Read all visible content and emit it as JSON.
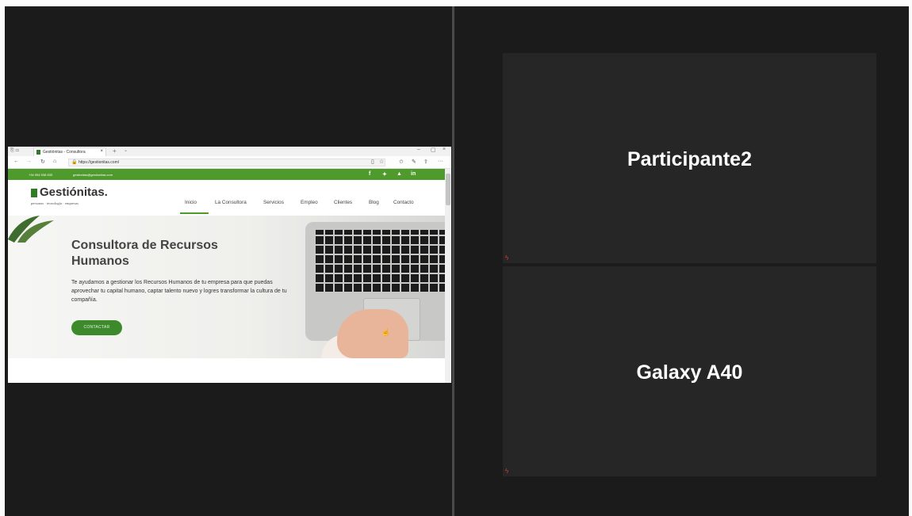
{
  "shared_browser": {
    "tab_title": "Gestiónitas - Consultora",
    "tab_close": "×",
    "new_tab": "+",
    "tab_list": "⌄",
    "window_controls": {
      "minimize": "–",
      "maximize": "▢",
      "close": "×"
    },
    "tab_action_icons": "⎘ ▭",
    "toolbar": {
      "back": "←",
      "forward": "→",
      "refresh": "↻",
      "home": "⌂",
      "lock": "🔒",
      "url": "https://gestionitas.com/",
      "reading_view": "▯",
      "favorite": "☆",
      "favorites": "✩",
      "notes": "✎",
      "share": "⇪",
      "more": "···"
    },
    "site": {
      "topbar_phone": "+34 954 538 833",
      "topbar_email": "gestiontas@gestionitas.com",
      "social": [
        "f",
        "✦",
        "▲",
        "in"
      ],
      "logo": "Gestiónitas.",
      "tagline": "personas · tecnología · empresas",
      "nav": [
        "Inicio",
        "La Consultora",
        "Servicios",
        "Empleo",
        "Clientes",
        "Blog",
        "Contacto"
      ],
      "hero_title": "Consultora de Recursos Humanos",
      "hero_text": "Te ayudamos a gestionar los Recursos Humanos de tu empresa para que puedas aprovechar tu capital humano, captar talento nuevo y logres transformar la cultura de tu compañía.",
      "hero_button": "CONTACTAR",
      "cursor": "☝"
    }
  },
  "participants": [
    {
      "name": "Participante2",
      "mic": "muted",
      "mic_icon": "ϟ"
    },
    {
      "name": "Galaxy A40",
      "mic": "muted",
      "mic_icon": "ϟ"
    }
  ],
  "colors": {
    "brand_green": "#4f9a2c",
    "muted_red": "#d23b2f",
    "tile_bg": "#262626"
  }
}
